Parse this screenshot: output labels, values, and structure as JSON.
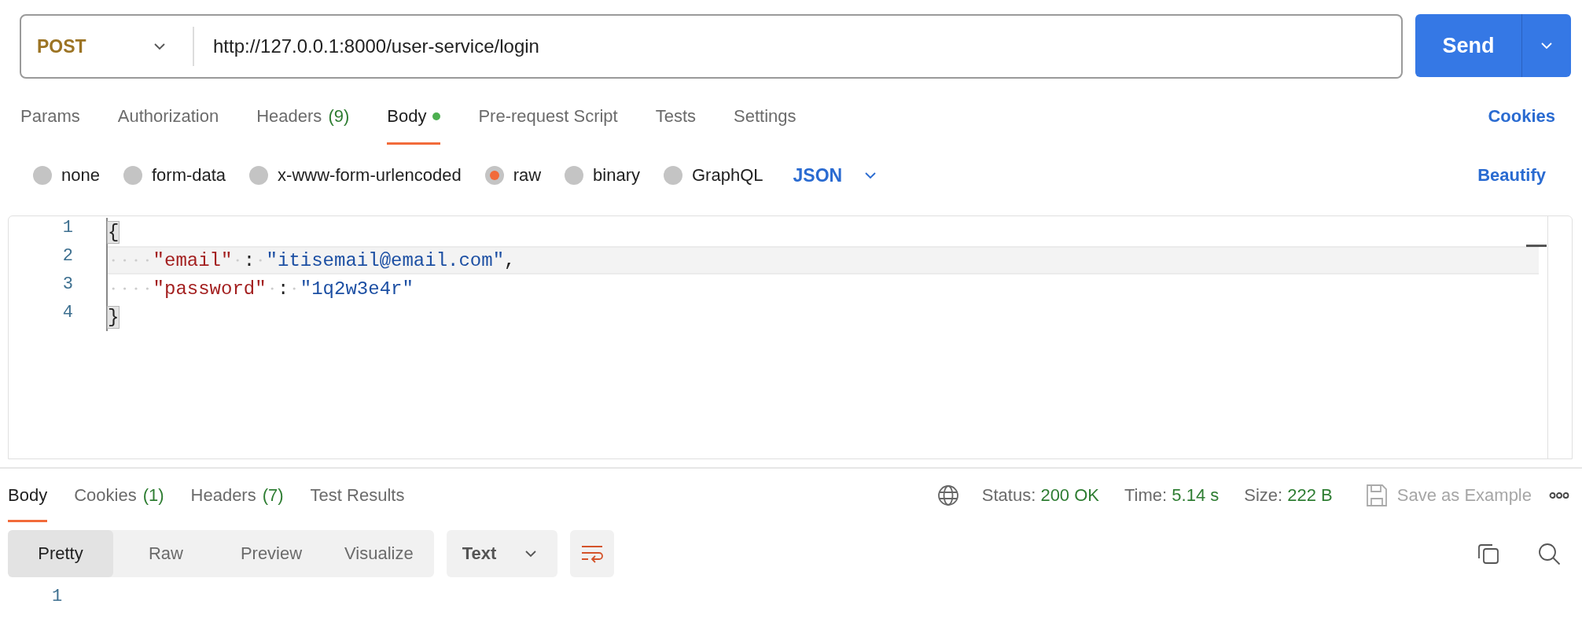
{
  "request": {
    "method": "POST",
    "url": "http://127.0.0.1:8000/user-service/login",
    "send": "Send"
  },
  "request_tabs": [
    {
      "label": "Params",
      "selected": false
    },
    {
      "label": "Authorization",
      "selected": false
    },
    {
      "label": "Headers",
      "count": "(9)",
      "selected": false
    },
    {
      "label": "Body",
      "indicator": true,
      "selected": true
    },
    {
      "label": "Pre-request Script",
      "selected": false
    },
    {
      "label": "Tests",
      "selected": false
    },
    {
      "label": "Settings",
      "selected": false
    }
  ],
  "cookies_link": "Cookies",
  "body_types": [
    {
      "label": "none",
      "selected": false
    },
    {
      "label": "form-data",
      "selected": false
    },
    {
      "label": "x-www-form-urlencoded",
      "selected": false
    },
    {
      "label": "raw",
      "selected": true
    },
    {
      "label": "binary",
      "selected": false
    },
    {
      "label": "GraphQL",
      "selected": false
    }
  ],
  "raw_format": "JSON",
  "beautify": "Beautify",
  "editor": {
    "lines": [
      {
        "number": "1",
        "active": false,
        "tokens": [
          {
            "kind": "bracket",
            "text": "{"
          }
        ]
      },
      {
        "number": "2",
        "active": true,
        "tokens": [
          {
            "kind": "indent"
          },
          {
            "kind": "key",
            "text": "\"email\""
          },
          {
            "kind": "space"
          },
          {
            "kind": "punct",
            "text": ":"
          },
          {
            "kind": "space"
          },
          {
            "kind": "string",
            "text": "\"itisemail@email.com\""
          },
          {
            "kind": "punct",
            "text": ","
          }
        ]
      },
      {
        "number": "3",
        "active": false,
        "tokens": [
          {
            "kind": "indent"
          },
          {
            "kind": "key",
            "text": "\"password\""
          },
          {
            "kind": "space"
          },
          {
            "kind": "punct",
            "text": ":"
          },
          {
            "kind": "space"
          },
          {
            "kind": "string",
            "text": "\"1q2w3e4r\""
          }
        ]
      },
      {
        "number": "4",
        "active": false,
        "tokens": [
          {
            "kind": "bracket",
            "text": "}"
          }
        ]
      }
    ]
  },
  "response": {
    "tabs": [
      {
        "label": "Body",
        "selected": true
      },
      {
        "label": "Cookies",
        "count": "(1)",
        "selected": false
      },
      {
        "label": "Headers",
        "count": "(7)",
        "selected": false
      },
      {
        "label": "Test Results",
        "selected": false
      }
    ],
    "stats": [
      {
        "label": "Status:",
        "value": "200 OK"
      },
      {
        "label": "Time:",
        "value": "5.14 s"
      },
      {
        "label": "Size:",
        "value": "222 B"
      }
    ],
    "save_example": {
      "label": "Save as Example",
      "disabled": true
    },
    "view_modes": [
      {
        "label": "Pretty",
        "selected": true
      },
      {
        "label": "Raw",
        "selected": false
      },
      {
        "label": "Preview",
        "selected": false
      },
      {
        "label": "Visualize",
        "selected": false
      }
    ],
    "format": "Text",
    "lines": [
      "1"
    ]
  }
}
